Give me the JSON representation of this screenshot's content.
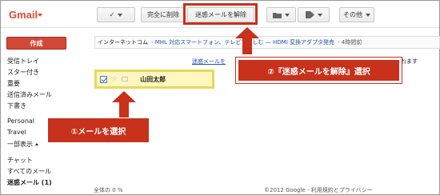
{
  "app": {
    "logo": "Gmail"
  },
  "toolbar": {
    "checkbox_icon": "✓",
    "delete_forever": "完全に削除",
    "not_spam": "迷惑メールを解除",
    "folder_icon": "folder-icon",
    "label_icon": "label-icon",
    "more": "その他"
  },
  "sidebar": {
    "compose": "作成",
    "items": [
      {
        "label": "受信トレイ"
      },
      {
        "label": "スター付き"
      },
      {
        "label": "重要"
      },
      {
        "label": "送信済みメール"
      },
      {
        "label": "下書き"
      },
      {
        "label": "Personal"
      },
      {
        "label": "Travel"
      },
      {
        "label": "一部表示"
      },
      {
        "label": "チャット"
      },
      {
        "label": "すべてのメール"
      },
      {
        "label": "迷惑メール (1)"
      }
    ]
  },
  "news": {
    "source": "インターネットコム",
    "headline": "- MHL 対応スマートフォン、テレビで楽しむ — HDMI 変換アダプタ発売",
    "time": "- 4時間前"
  },
  "notice": {
    "link": "迷惑メールを",
    "rest": "削除されます"
  },
  "mail": {
    "sender": "山田太郎"
  },
  "annotations": {
    "step1": "①メールを選択",
    "step2": "②『迷惑メールを解除』選択"
  },
  "footer": {
    "usage": "全体の 0 %",
    "copyright": "©2012 Google - 利用規約とプライバシー"
  },
  "colors": {
    "accent_red": "#c8311b",
    "compose_red": "#d14836",
    "row_highlight": "#fff7bf"
  }
}
